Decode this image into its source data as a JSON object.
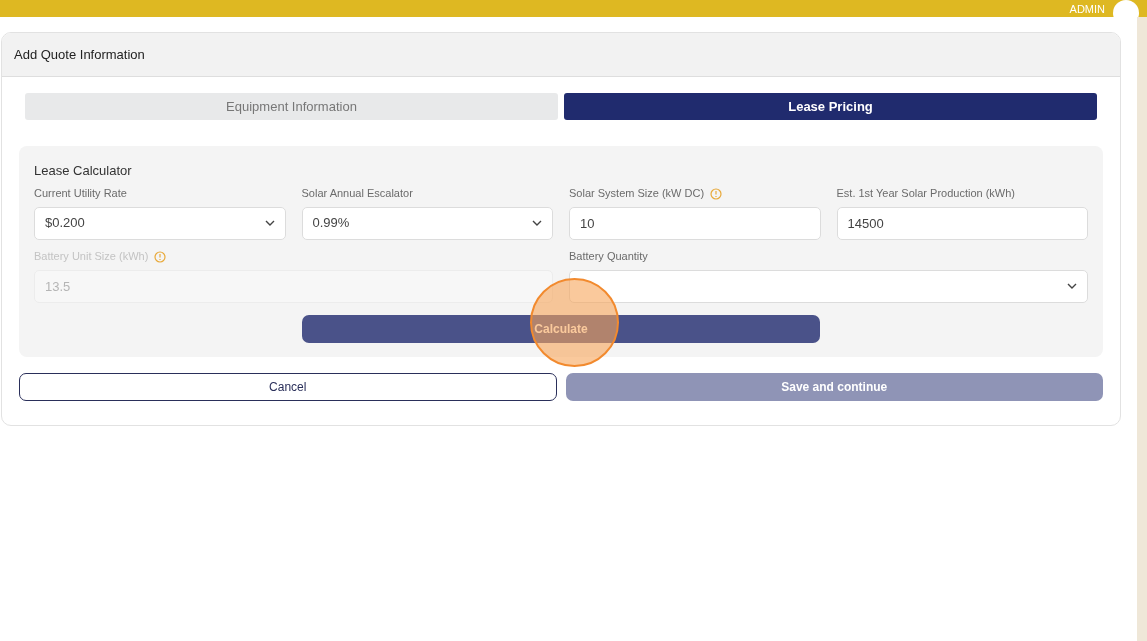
{
  "top_bar": {
    "user_label": "ADMIN"
  },
  "card": {
    "title": "Add Quote Information",
    "tabs": [
      {
        "label": "Equipment Information",
        "selected": false
      },
      {
        "label": "Lease Pricing",
        "selected": true
      }
    ],
    "calculator": {
      "title": "Lease Calculator",
      "fields": [
        {
          "kind": "select",
          "label": "Current Utility Rate",
          "value": "$0.200",
          "disabled": false
        },
        {
          "kind": "select",
          "label": "Solar Annual Escalator",
          "value": "0.99%",
          "disabled": false
        },
        {
          "kind": "input",
          "label": "Solar System Size (kW DC)",
          "value": "10",
          "info": true,
          "disabled": false
        },
        {
          "kind": "input",
          "label": "Est. 1st Year Solar Production (kWh)",
          "value": "14500",
          "disabled": false
        },
        {
          "kind": "input",
          "label": "Battery Unit Size (kWh)",
          "value": "13.5",
          "info": true,
          "disabled": true
        },
        {
          "kind": "select",
          "label": "Battery Quantity",
          "disabled": false
        }
      ],
      "calculate_button": "Calculate"
    },
    "buttons": [
      {
        "kind": "outline",
        "label": "Cancel"
      },
      {
        "kind": "primary",
        "label": "Save and continue",
        "disabled": true
      }
    ]
  }
}
